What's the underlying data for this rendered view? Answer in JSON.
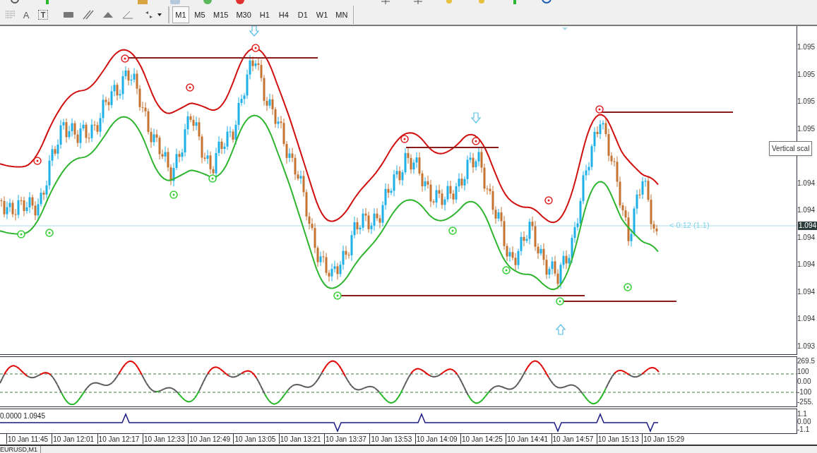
{
  "toolbar": {
    "text_tool": "A",
    "text_label_tool": "T",
    "timeframes": [
      {
        "label": "M1",
        "selected": true
      },
      {
        "label": "M5",
        "selected": false
      },
      {
        "label": "M15",
        "selected": false
      },
      {
        "label": "M30",
        "selected": false
      },
      {
        "label": "H1",
        "selected": false
      },
      {
        "label": "H4",
        "selected": false
      },
      {
        "label": "D1",
        "selected": false
      },
      {
        "label": "W1",
        "selected": false
      },
      {
        "label": "MN",
        "selected": false
      }
    ]
  },
  "main_chart": {
    "price_labels_upper": [
      "1.095",
      "1.095",
      "1.095",
      "1.095"
    ],
    "price_labels_lower": [
      "1.094",
      "1.094",
      "1.094",
      "1.094",
      "1.094",
      "1.094",
      "1.093"
    ],
    "current_price": "1.094",
    "timer_label": "< 0:12 (1.1)",
    "tooltip": "Vertical scal"
  },
  "oscillator": {
    "scale_labels": [
      "269.5",
      "100",
      "0.00",
      "-100",
      "-255."
    ]
  },
  "signal_pane": {
    "legend": "0.0000 1.0945",
    "scale_labels": [
      "1.1",
      "0.00",
      "-1.1"
    ]
  },
  "time_labels": [
    "10 Jan 11:45",
    "10 Jan 12:01",
    "10 Jan 12:17",
    "10 Jan 12:33",
    "10 Jan 12:49",
    "10 Jan 13:05",
    "10 Jan 13:21",
    "10 Jan 13:37",
    "10 Jan 13:53",
    "10 Jan 14:09",
    "10 Jan 14:25",
    "10 Jan 14:41",
    "10 Jan 14:57",
    "10 Jan 15:13",
    "10 Jan 15:29"
  ],
  "tab": {
    "label": "EURUSD,M1"
  }
}
